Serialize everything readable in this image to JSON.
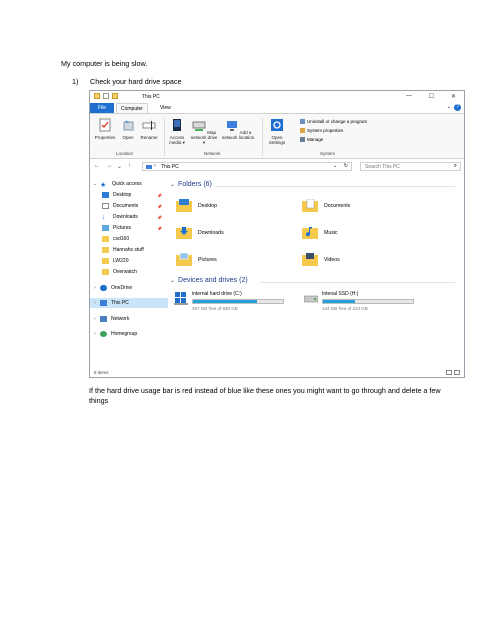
{
  "document": {
    "intro": "My computer is being slow.",
    "step_number": "1)",
    "step_text": "Check your hard drive space",
    "footer": "If the hard drive usage bar is red instead of blue like these ones you might want to go through and delete a few things"
  },
  "window": {
    "title": "This PC",
    "controls": {
      "minimize": "—",
      "maximize": "☐",
      "close": "✕"
    },
    "tabs": {
      "file": "File",
      "computer": "Computer",
      "view": "View"
    },
    "help": "?",
    "ribbon": {
      "location": {
        "properties": "Properties",
        "open": "Open",
        "rename": "Rename",
        "label": "Location"
      },
      "network": {
        "access_media": "Access media ▾",
        "map_network_drive": "Map network drive ▾",
        "add_network_location": "Add a network location",
        "label": "Network"
      },
      "system": {
        "open_settings": "Open Settings",
        "uninstall": "Uninstall or change a program",
        "system_properties": "System properties",
        "manage": "Manage",
        "label": "System"
      }
    },
    "address": {
      "path": "This PC",
      "search_placeholder": "Search This PC"
    },
    "nav": {
      "quick_access": "Quick access",
      "pinned": [
        "Desktop",
        "Documents",
        "Downloads",
        "Pictures"
      ],
      "recent": [
        "csd160",
        "Hannahs stuff",
        "LW220",
        "Overwatch"
      ],
      "onedrive": "OneDrive",
      "this_pc": "This PC",
      "network": "Network",
      "homegroup": "Homegroup"
    },
    "folders_header": "Folders (6)",
    "folders": [
      "Desktop",
      "Documents",
      "Downloads",
      "Music",
      "Pictures",
      "Videos"
    ],
    "drives_header": "Devices and drives (2)",
    "drives": [
      {
        "name": "internal hard drive (C:)",
        "free": "267 GB free of 930 GB",
        "used_fraction": 0.71
      },
      {
        "name": "Intenal SSD (H:)",
        "free": "144 GB free of 223 GB",
        "used_fraction": 0.35
      }
    ],
    "status": "8 items",
    "accent_color": "#1e6fcf",
    "bar_color": "#26a0da"
  }
}
